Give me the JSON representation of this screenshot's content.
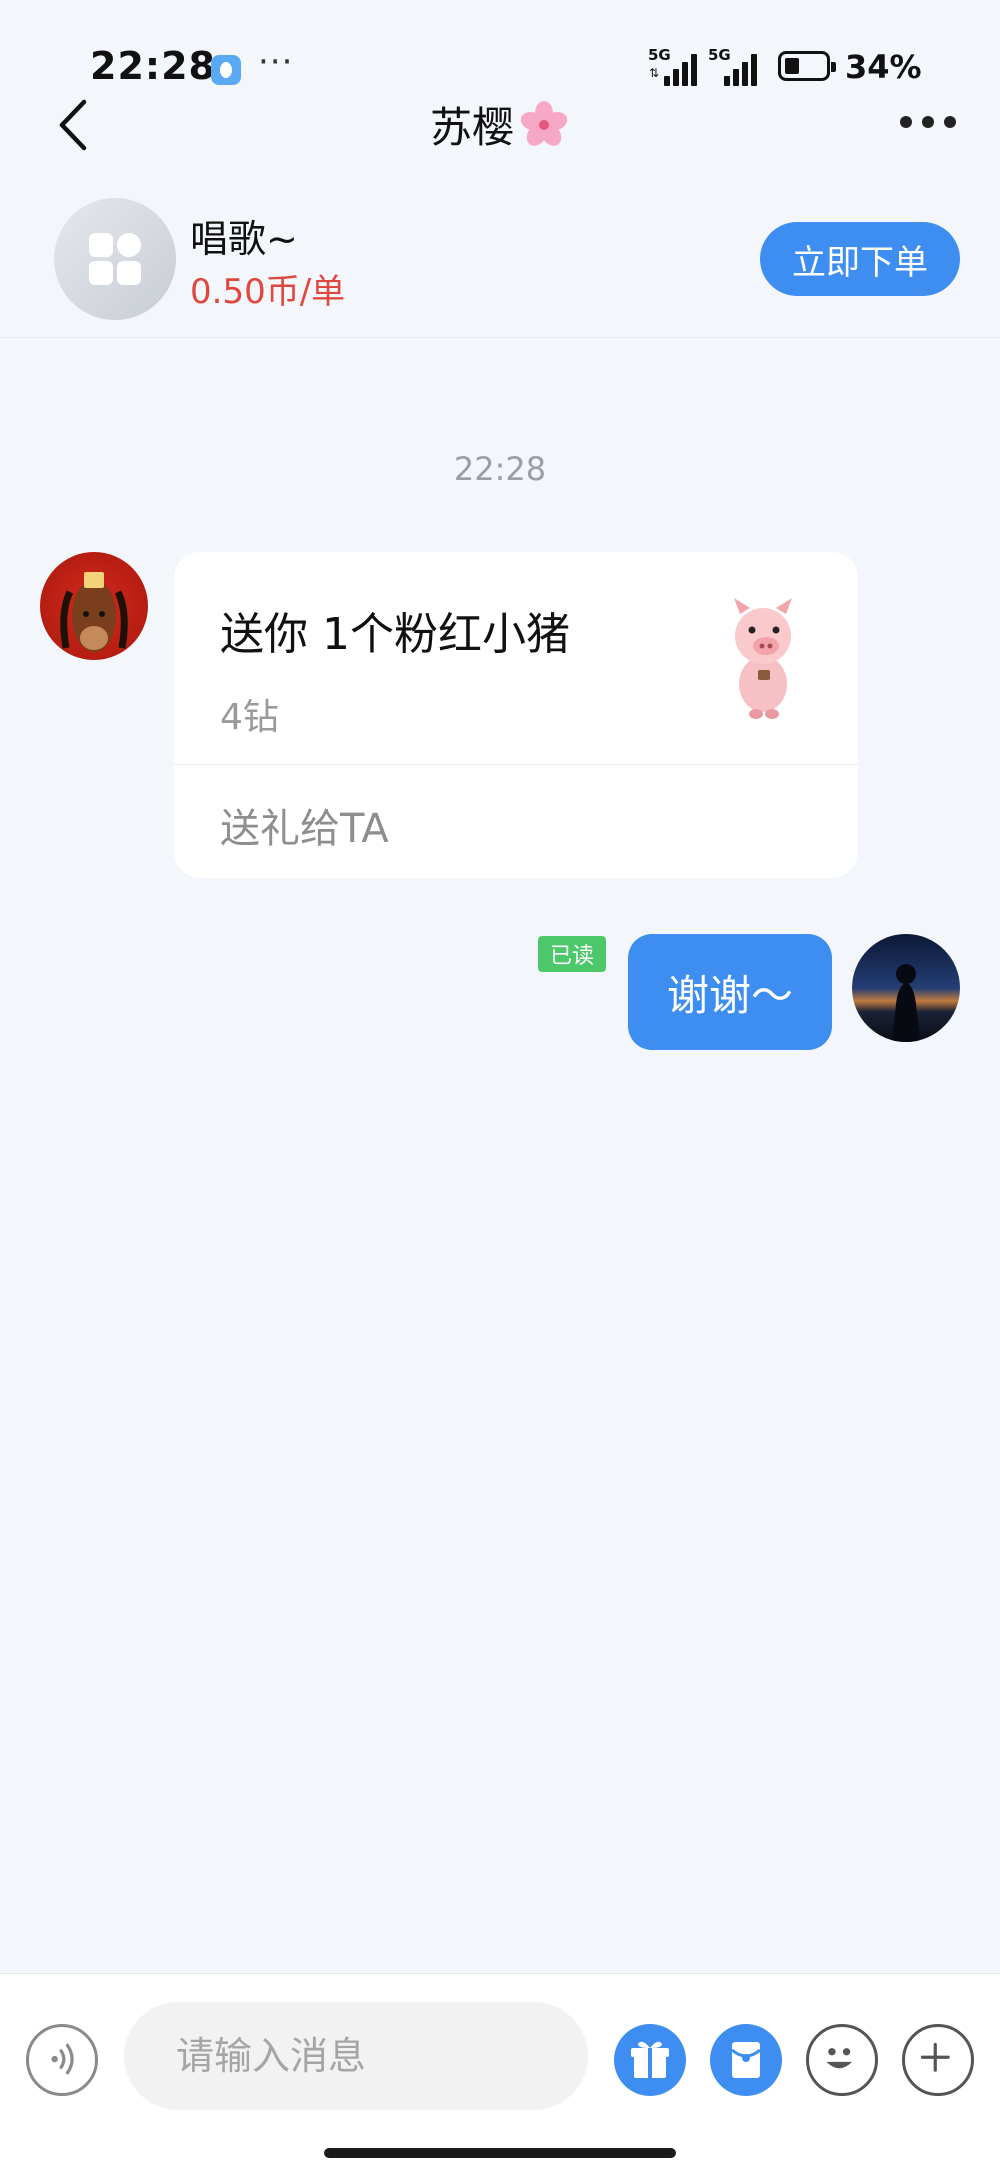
{
  "status_bar": {
    "time": "22:28",
    "more": "···",
    "signal1": "5G",
    "signal2": "5G",
    "battery": "34%"
  },
  "header": {
    "title": "苏樱",
    "back_icon": "chevron-left-icon",
    "more_icon": "more-dots-icon"
  },
  "service": {
    "name": "唱歌~",
    "price": "0.50币/单",
    "order_button": "立即下单"
  },
  "chat": {
    "timestamp": "22:28",
    "gift_message": {
      "title": "送你 1个粉红小猪",
      "price": "4钻",
      "action": "送礼给TA"
    },
    "outgoing": {
      "read_status": "已读",
      "text": "谢谢～"
    }
  },
  "input_bar": {
    "placeholder": "请输入消息",
    "icons": [
      "voice-icon",
      "gift-icon",
      "red-packet-icon",
      "emoji-icon",
      "plus-icon"
    ]
  },
  "colors": {
    "accent": "#3d8ef0",
    "price_red": "#e0473f",
    "read_green": "#4cc86a",
    "background": "#f3f6fa"
  }
}
